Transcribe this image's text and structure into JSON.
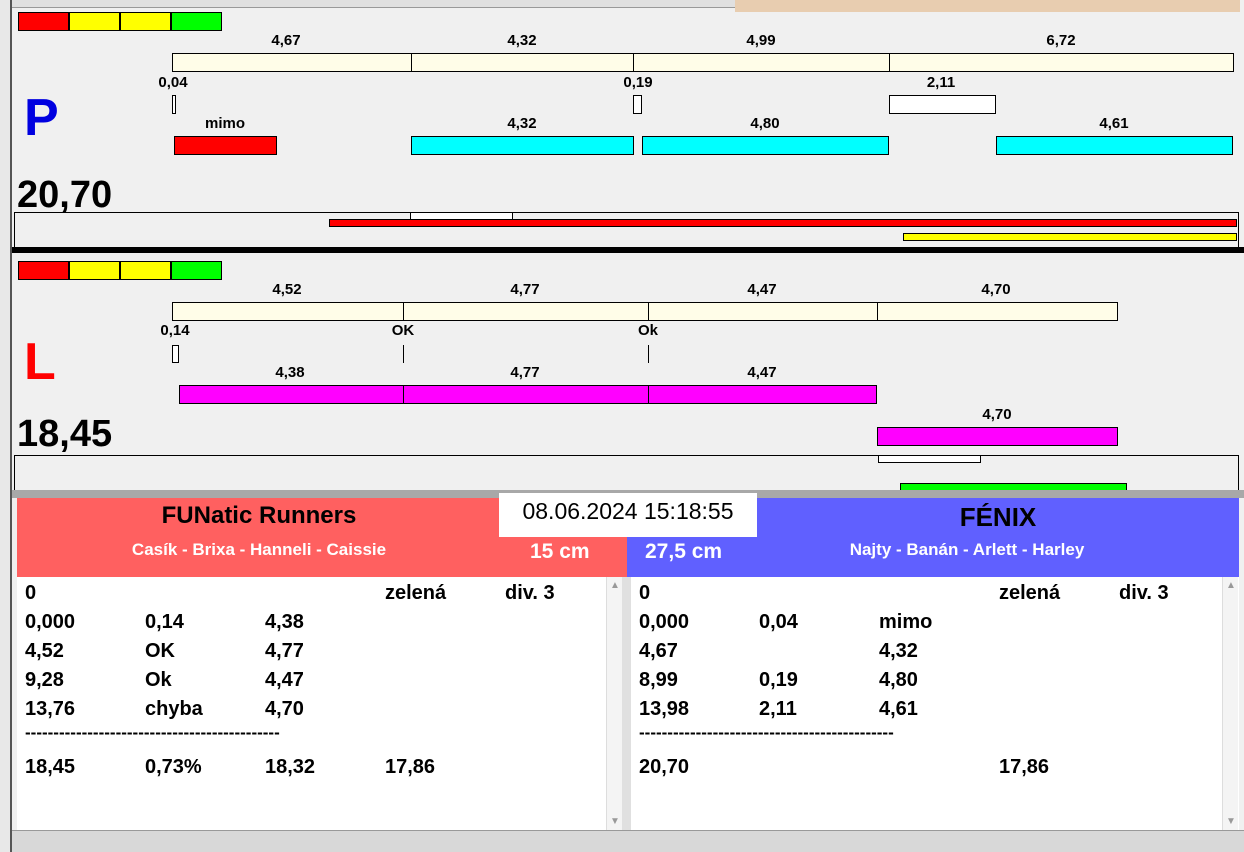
{
  "colors": {
    "team_left": "#ff6060",
    "team_right": "#6060ff",
    "cyan": "#00ffff",
    "magenta": "#ff00ff",
    "cream": "#fffde8"
  },
  "p": {
    "side": "P",
    "total": "20,70",
    "row1": [
      "4,67",
      "4,32",
      "4,99",
      "6,72"
    ],
    "row2": [
      "0,04",
      "0,19",
      "2,11"
    ],
    "row3": [
      "mimo",
      "4,32",
      "4,80",
      "4,61"
    ]
  },
  "l": {
    "side": "L",
    "total": "18,45",
    "row1": [
      "4,52",
      "4,77",
      "4,47",
      "4,70"
    ],
    "row2": [
      "0,14",
      "OK",
      "Ok"
    ],
    "row3": [
      "4,38",
      "4,77",
      "4,47",
      "4,70"
    ]
  },
  "datetime": "08.06.2024 15:18:55",
  "left_team": {
    "name": "FUNatic Runners",
    "members": "Casík - Brixa - Hanneli - Caissie",
    "height": "15 cm",
    "rows": [
      [
        "0",
        "",
        "",
        "zelená",
        "div. 3"
      ],
      [
        "0,000",
        "0,14",
        "4,38",
        "",
        ""
      ],
      [
        "4,52",
        "OK",
        "4,77",
        "",
        ""
      ],
      [
        "9,28",
        "Ok",
        "4,47",
        "",
        ""
      ],
      [
        "13,76",
        "chyba",
        "4,70",
        "",
        ""
      ],
      [
        "18,45",
        "0,73%",
        "18,32",
        "17,86",
        ""
      ]
    ]
  },
  "right_team": {
    "name": "FÉNIX",
    "members": "Najty - Banán - Arlett - Harley",
    "height": "27,5 cm",
    "rows": [
      [
        "0",
        "",
        "",
        "zelená",
        "div. 3"
      ],
      [
        "0,000",
        "0,04",
        "mimo",
        "",
        ""
      ],
      [
        "4,67",
        "",
        "4,32",
        "",
        ""
      ],
      [
        "8,99",
        "0,19",
        "4,80",
        "",
        ""
      ],
      [
        "13,98",
        "2,11",
        "4,61",
        "",
        ""
      ],
      [
        "20,70",
        "",
        "",
        "17,86",
        ""
      ]
    ]
  },
  "divider": "---------------------------------------------"
}
